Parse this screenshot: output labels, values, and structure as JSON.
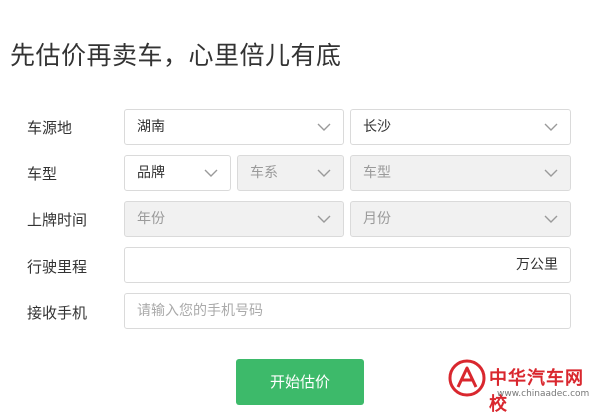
{
  "header": {
    "title": "先估价再卖车，心里倍儿有底"
  },
  "form": {
    "location": {
      "label": "车源地",
      "province": "湖南",
      "city": "长沙"
    },
    "model": {
      "label": "车型",
      "brand": "品牌",
      "series": "车系",
      "model": "车型"
    },
    "registration": {
      "label": "上牌时间",
      "year": "年份",
      "month": "月份"
    },
    "mileage": {
      "label": "行驶里程",
      "value": "",
      "unit": "万公里"
    },
    "phone": {
      "label": "接收手机",
      "placeholder": "请输入您的手机号码"
    },
    "submit_label": "开始估价"
  },
  "watermark": {
    "title": "中华汽车网校",
    "url": "www.chinaadec.com"
  },
  "colors": {
    "accent": "#3dba6a",
    "border": "#dadada",
    "disabled_bg": "#f1f1f1",
    "watermark_red": "#d9272e"
  },
  "icons": {
    "dropdown": "chevron-down-icon",
    "watermark_logo": "chinaadec-logo-icon"
  }
}
